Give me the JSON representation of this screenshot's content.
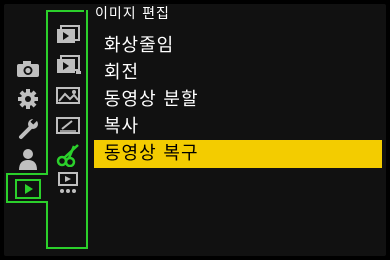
{
  "header": {
    "title": "이미지 편집"
  },
  "menu": {
    "items": [
      {
        "label": "화상줄임"
      },
      {
        "label": "회전"
      },
      {
        "label": "동영상 분할"
      },
      {
        "label": "복사"
      },
      {
        "label": "동영상 복구"
      }
    ],
    "selected_index": 4
  },
  "main_categories": [
    {
      "icon": "camera-icon"
    },
    {
      "icon": "gear-icon"
    },
    {
      "icon": "wrench-icon"
    },
    {
      "icon": "person-icon"
    },
    {
      "icon": "playback-icon"
    }
  ],
  "sub_tabs": [
    {
      "icon": "playback-slideshow-icon"
    },
    {
      "icon": "playback-mode-icon"
    },
    {
      "icon": "image-process-icon"
    },
    {
      "icon": "add-info-icon"
    },
    {
      "icon": "scissors-icon"
    },
    {
      "icon": "others-icon"
    }
  ],
  "colors": {
    "accent_green": "#2bd02b",
    "selection_yellow": "#f3cc00",
    "icon_gray": "#bfbfbf"
  }
}
